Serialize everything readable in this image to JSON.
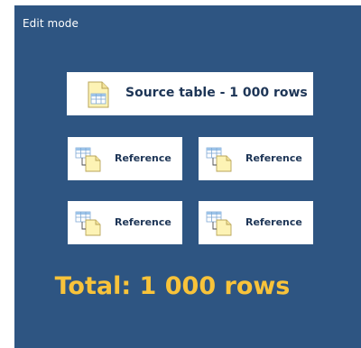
{
  "header": {
    "mode_label": "Edit mode"
  },
  "source": {
    "label": "Source table - 1 000 rows",
    "icon": "document-table-icon"
  },
  "references": [
    {
      "label": "Reference",
      "icon": "linked-table-icon"
    },
    {
      "label": "Reference",
      "icon": "linked-table-icon"
    },
    {
      "label": "Reference",
      "icon": "linked-table-icon"
    },
    {
      "label": "Reference",
      "icon": "linked-table-icon"
    }
  ],
  "total": {
    "label": "Total: 1 000 rows"
  },
  "colors": {
    "background": "#2e5582",
    "card": "#ffffff",
    "text_dark": "#1d3556",
    "total_accent": "#f8c33a",
    "doc_fill": "#fdf3b5",
    "table_blue": "#9cc3e8"
  }
}
